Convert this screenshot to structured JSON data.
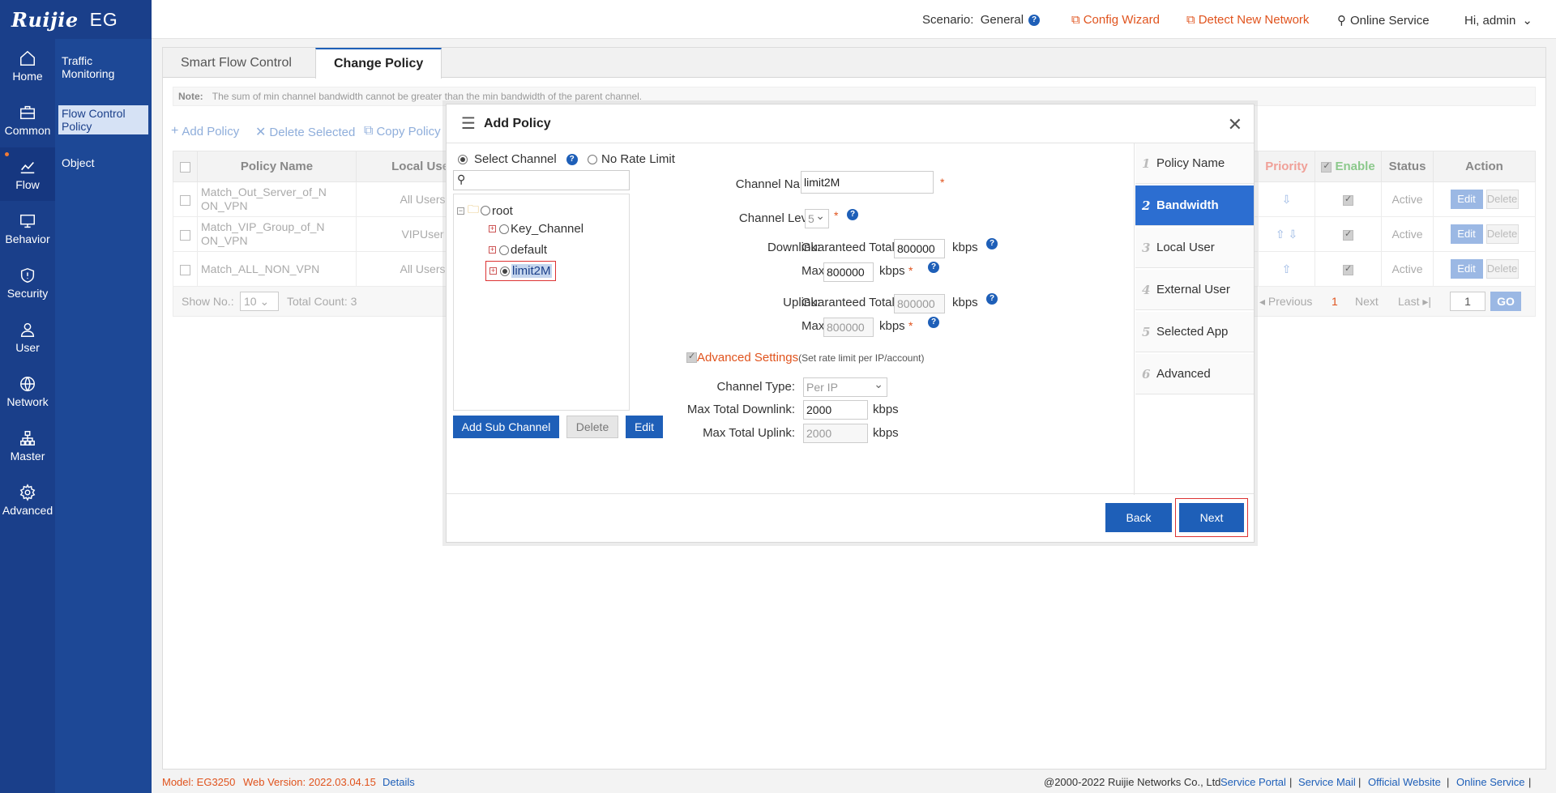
{
  "brand": {
    "logo": "Ruijie",
    "product": "EG"
  },
  "topbar": {
    "scenario_label": "Scenario:",
    "scenario_value": "General",
    "config_wizard": "Config Wizard",
    "detect_network": "Detect New Network",
    "online_service": "Online Service",
    "user": "Hi, admin"
  },
  "rail": [
    {
      "label": "Home",
      "icon": "home-icon"
    },
    {
      "label": "Common",
      "icon": "briefcase-icon"
    },
    {
      "label": "Flow",
      "icon": "chart-icon"
    },
    {
      "label": "Behavior",
      "icon": "monitor-icon"
    },
    {
      "label": "Security",
      "icon": "shield-icon"
    },
    {
      "label": "User",
      "icon": "user-icon"
    },
    {
      "label": "Network",
      "icon": "globe-icon"
    },
    {
      "label": "Master",
      "icon": "hierarchy-icon"
    },
    {
      "label": "Advanced",
      "icon": "gear-icon"
    }
  ],
  "subnav": [
    "Traffic Monitoring",
    "Flow Control Policy",
    "Object"
  ],
  "tabs": [
    "Smart Flow Control",
    "Change Policy"
  ],
  "note": {
    "label": "Note:",
    "text": "The sum of min channel bandwidth cannot be greater than the min bandwidth of the parent channel."
  },
  "toolbar": {
    "add": "Add Policy",
    "delete": "Delete Selected",
    "copy": "Copy Policy"
  },
  "table": {
    "headers": [
      "Policy Name",
      "Local User",
      "Priority",
      "Enable",
      "Status",
      "Action"
    ],
    "rows": [
      {
        "name": "Match_Out_Server_of_N ON_VPN",
        "user": "All Users",
        "status": "Active"
      },
      {
        "name": "Match_VIP_Group_of_N ON_VPN",
        "user": "VIPUser",
        "status": "Active"
      },
      {
        "name": "Match_ALL_NON_VPN",
        "user": "All Users",
        "status": "Active"
      }
    ],
    "edit": "Edit",
    "delete": "Delete",
    "show_no_label": "Show No.:",
    "show_no_value": "10",
    "total_count": "Total Count: 3",
    "pager": {
      "previous": "Previous",
      "current": "1",
      "next": "Next",
      "last": "Last",
      "page_input": "1",
      "go": "GO"
    }
  },
  "modal": {
    "title": "Add Policy",
    "select_channel": "Select Channel",
    "no_rate_limit": "No Rate Limit",
    "tree": {
      "root": "root",
      "children": [
        "Key_Channel",
        "default",
        "limit2M"
      ]
    },
    "add_sub_channel": "Add Sub Channel",
    "delete": "Delete",
    "edit": "Edit",
    "form": {
      "channel_name_label": "Channel Name:",
      "channel_name_value": "limit2M",
      "channel_level_label": "Channel Level:",
      "channel_level_value": "5",
      "downlink_label": "Downlink:",
      "guaranteed_total": "Guaranteed Total",
      "downlink_guaranteed": "800000",
      "max_label": "Max",
      "downlink_max": "800000",
      "uplink_label": "Uplink:",
      "uplink_guaranteed": "800000",
      "uplink_max": "800000",
      "kbps": "kbps",
      "advanced_settings": "Advanced Settings",
      "advanced_hint": "(Set rate limit per IP/account)",
      "channel_type_label": "Channel Type:",
      "channel_type_value": "Per IP",
      "max_total_downlink_label": "Max Total Downlink:",
      "max_total_downlink_value": "2000",
      "max_total_uplink_label": "Max Total Uplink:",
      "max_total_uplink_value": "2000"
    },
    "steps": [
      "Policy Name",
      "Bandwidth",
      "Local User",
      "External User",
      "Selected App",
      "Advanced"
    ],
    "back": "Back",
    "next": "Next"
  },
  "footer": {
    "model_label": "Model:",
    "model": "EG3250",
    "web_version_label": "Web Version:",
    "web_version": "2022.03.04.15",
    "details": "Details",
    "copyright": "@2000-2022 Ruijie Networks Co., Ltd",
    "links": [
      "Service Portal",
      "Service Mail",
      "Official Website",
      "Online Service"
    ]
  }
}
